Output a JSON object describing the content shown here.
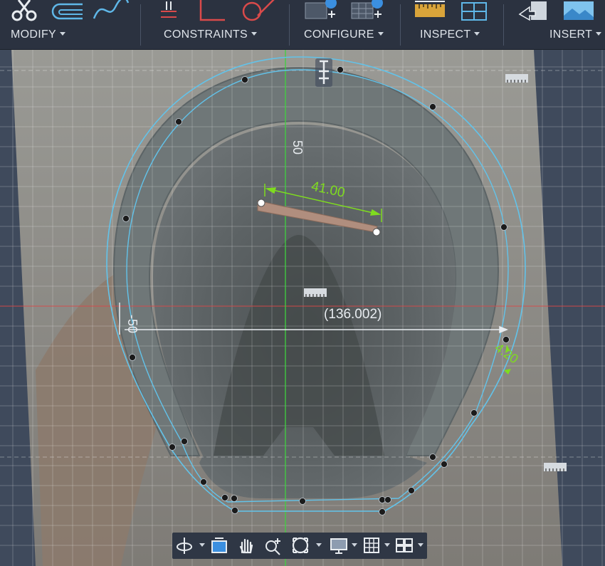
{
  "toolbar": {
    "groups": [
      {
        "label": "MODIFY"
      },
      {
        "label": "CONSTRAINTS"
      },
      {
        "label": "CONFIGURE"
      },
      {
        "label": "INSPECT"
      },
      {
        "label": "INSERT"
      }
    ]
  },
  "canvas": {
    "dimensions": {
      "nail_length": "41.00",
      "horizontal_ref": "(136.002)",
      "vertical_tick": "50",
      "left_tick": "-50",
      "offset": "4.20"
    },
    "colors": {
      "sketch_profile": "#62c3ea",
      "dimension": "#7fdc1f",
      "y_axis": "#3fd23f",
      "x_axis": "#d94a4a",
      "grid": "#ffffff"
    }
  },
  "navbar": {
    "tools": [
      "orbit-icon",
      "look-at-icon",
      "pan-icon",
      "zoom-icon",
      "fit-icon",
      "display-settings-icon",
      "grid-settings-icon",
      "viewports-icon"
    ]
  }
}
